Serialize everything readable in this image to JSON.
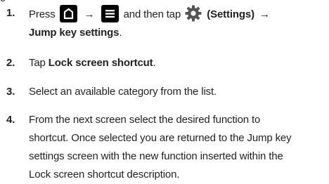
{
  "partial_top_line": "g",
  "steps": [
    {
      "number": "1.",
      "press": "Press",
      "and_then_tap": "and then tap",
      "settings_label": "(Settings)",
      "arrow": "→",
      "destination": "Jump key settings",
      "period": ".",
      "icons": [
        "home-button-icon",
        "menu-button-icon",
        "settings-gear-icon"
      ]
    },
    {
      "number": "2.",
      "tap": "Tap",
      "target": "Lock screen shortcut",
      "period": "."
    },
    {
      "number": "3.",
      "text": "Select an available category from the list."
    },
    {
      "number": "4.",
      "lines": [
        "From the next screen select the desired function to",
        "shortcut. Once selected you are returned to the Jump key",
        "settings screen with the new function inserted within the",
        "Lock screen shortcut description."
      ]
    }
  ]
}
